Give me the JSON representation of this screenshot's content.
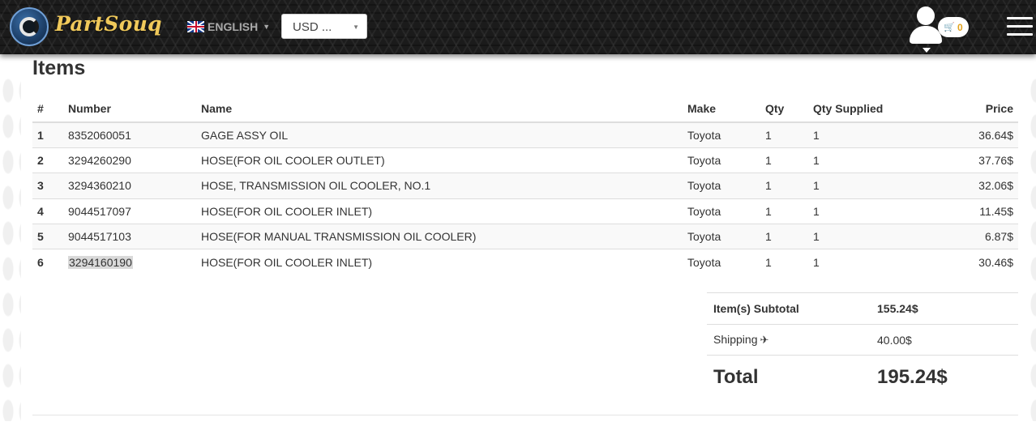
{
  "header": {
    "logo_text": "PartSouq",
    "language": "ENGLISH",
    "currency": "USD ...",
    "cart_count": "0"
  },
  "icons": {
    "logo": "partsouq-logo-icon",
    "flag": "uk-flag-icon",
    "user": "user-icon",
    "cart": "cart-icon",
    "menu": "hamburger-menu-icon",
    "shipping": "airplane-icon"
  },
  "page": {
    "title": "Items"
  },
  "table": {
    "columns": [
      "#",
      "Number",
      "Name",
      "Make",
      "Qty",
      "Qty Supplied",
      "Price"
    ],
    "rows": [
      {
        "idx": "1",
        "number": "8352060051",
        "name": "GAGE ASSY OIL",
        "make": "Toyota",
        "qty": "1",
        "supplied": "1",
        "price": "36.64$"
      },
      {
        "idx": "2",
        "number": "3294260290",
        "name": "HOSE(FOR OIL COOLER OUTLET)",
        "make": "Toyota",
        "qty": "1",
        "supplied": "1",
        "price": "37.76$"
      },
      {
        "idx": "3",
        "number": "3294360210",
        "name": "HOSE, TRANSMISSION OIL COOLER, NO.1",
        "make": "Toyota",
        "qty": "1",
        "supplied": "1",
        "price": "32.06$"
      },
      {
        "idx": "4",
        "number": "9044517097",
        "name": "HOSE(FOR OIL COOLER INLET)",
        "make": "Toyota",
        "qty": "1",
        "supplied": "1",
        "price": "11.45$"
      },
      {
        "idx": "5",
        "number": "9044517103",
        "name": "HOSE(FOR MANUAL TRANSMISSION OIL COOLER)",
        "make": "Toyota",
        "qty": "1",
        "supplied": "1",
        "price": "6.87$"
      },
      {
        "idx": "6",
        "number": "3294160190",
        "name": "HOSE(FOR OIL COOLER INLET)",
        "make": "Toyota",
        "qty": "1",
        "supplied": "1",
        "price": "30.46$"
      }
    ]
  },
  "summary": {
    "subtotal_label": "Item(s) Subtotal",
    "subtotal_value": "155.24$",
    "shipping_label": "Shipping",
    "shipping_value": "40.00$",
    "total_label": "Total",
    "total_value": "195.24$"
  },
  "colors": {
    "header_bg": "#1b1b1b",
    "logo_text": "#f0c95a",
    "cart_count": "#e2a21d",
    "row_stripe": "#f9f9f9",
    "border": "#dddddd",
    "highlight": "#d9d9d9"
  }
}
